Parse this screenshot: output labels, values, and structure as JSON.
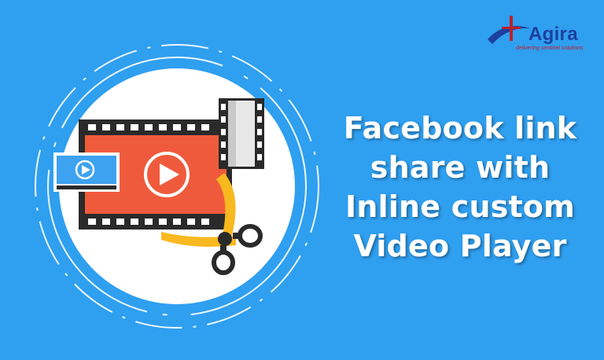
{
  "headline": {
    "lines": [
      "Facebook link",
      "share with",
      "Inline custom",
      "Video Player"
    ]
  },
  "brand": {
    "name": "Agira",
    "tagline": "delivering sentinel solutions"
  },
  "colors": {
    "background": "#2f9ff0",
    "circle": "#ffffff",
    "film_strip": "#f05a3c",
    "film_strip_dark": "#2a2a2a",
    "scissors": "#f8b820",
    "monitor": "#3da2f0",
    "brand_blue": "#1d3f9e",
    "brand_red": "#c0202a"
  },
  "icons": [
    "play-icon",
    "scissors-icon",
    "monitor-icon",
    "film-strip-icon"
  ]
}
